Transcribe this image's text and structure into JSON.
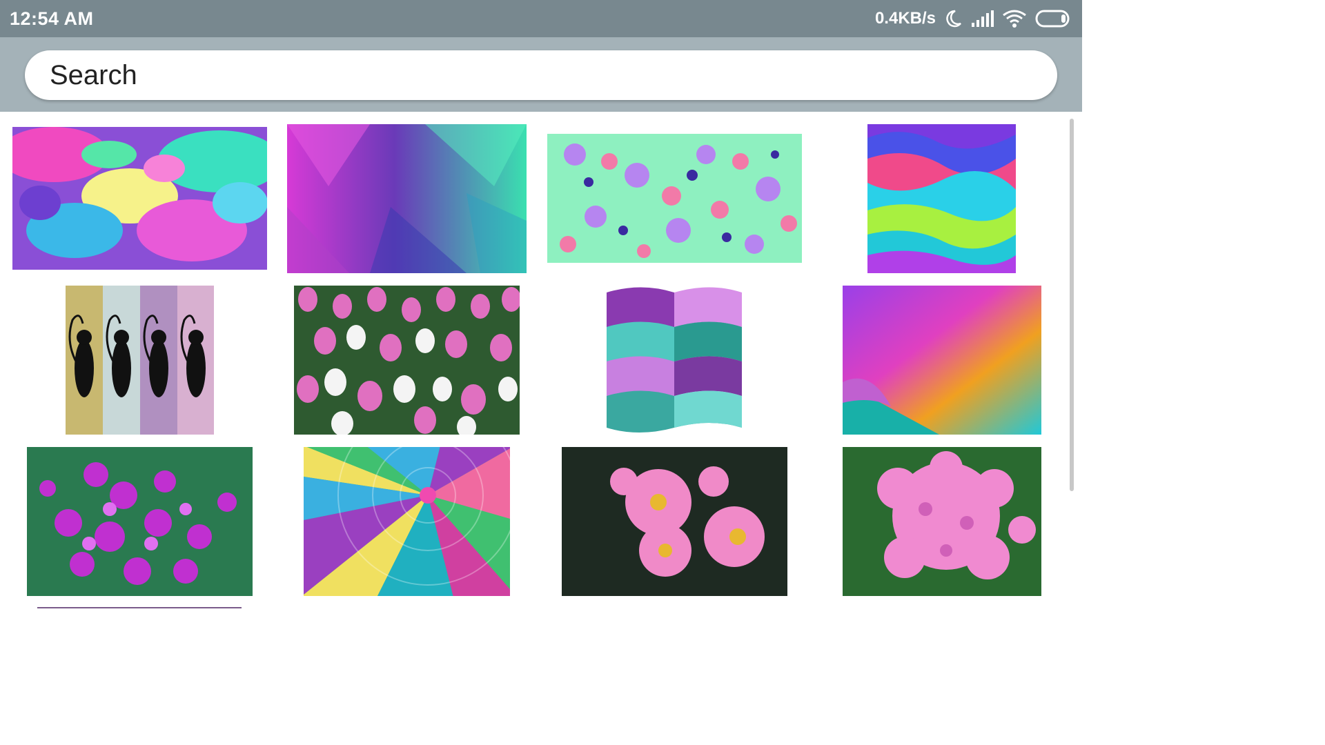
{
  "status_bar": {
    "time": "12:54 AM",
    "network_speed": "0.4KB/s",
    "icons": [
      "moon-icon",
      "signal-icon",
      "wifi-icon",
      "battery-icon"
    ]
  },
  "search": {
    "placeholder": "Search"
  },
  "images": [
    {
      "name": "abstract-paint-splash"
    },
    {
      "name": "polygon-magenta-teal"
    },
    {
      "name": "floral-pattern-mint"
    },
    {
      "name": "wavy-rainbow-layers"
    },
    {
      "name": "black-cats-panels"
    },
    {
      "name": "pink-tulip-field"
    },
    {
      "name": "woven-wave-flag"
    },
    {
      "name": "page-curl-gradient"
    },
    {
      "name": "purple-flowers"
    },
    {
      "name": "hot-air-balloon"
    },
    {
      "name": "pink-wild-roses"
    },
    {
      "name": "pink-hydrangea"
    }
  ]
}
